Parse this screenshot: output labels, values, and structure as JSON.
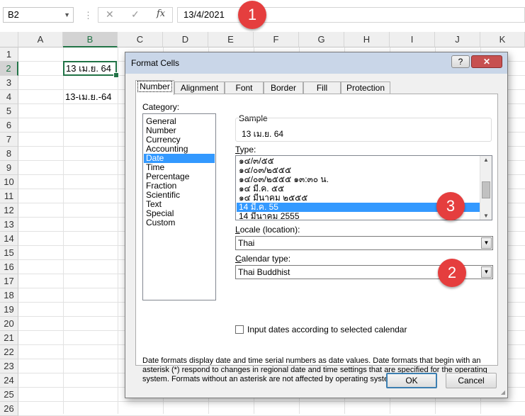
{
  "formula_bar": {
    "name_box": "B2",
    "cancel_symbol": "✕",
    "enter_symbol": "✓",
    "fx_symbol": "fx",
    "formula": "13/4/2021"
  },
  "sheet": {
    "columns": [
      "A",
      "B",
      "C",
      "D",
      "E",
      "F",
      "G",
      "H",
      "I",
      "J",
      "K"
    ],
    "selected_column": "B",
    "rows": [
      "1",
      "2",
      "3",
      "4",
      "5",
      "6",
      "7",
      "8",
      "9",
      "10",
      "11",
      "12",
      "13",
      "14",
      "15",
      "16",
      "17",
      "18",
      "19",
      "20",
      "21",
      "22",
      "23",
      "24",
      "25",
      "26"
    ],
    "selected_row": "2",
    "cells": {
      "B2": "13 เม.ย. 64",
      "B4": "13-เม.ย.-64"
    }
  },
  "badges": [
    "1",
    "2",
    "3"
  ],
  "dialog": {
    "title": "Format Cells",
    "help": "?",
    "close": "✕",
    "tabs": [
      "Number",
      "Alignment",
      "Font",
      "Border",
      "Fill",
      "Protection"
    ],
    "active_tab": "Number",
    "category_label": "Category:",
    "categories": [
      "General",
      "Number",
      "Currency",
      "Accounting",
      "Date",
      "Time",
      "Percentage",
      "Fraction",
      "Scientific",
      "Text",
      "Special",
      "Custom"
    ],
    "selected_category": "Date",
    "sample_label": "Sample",
    "sample_value": "13 เม.ย. 64",
    "type_label": "Type:",
    "types": [
      "๑๔/๓/๕๕",
      "๑๔/๐๓/๒๕๕๕",
      "๑๔/๐๓/๒๕๕๕ ๑๓:๓๐ น.",
      "๑๔ มี.ค. ๕๕",
      "๑๔ มีนาคม ๒๕๕๕",
      "14 มี.ค. 55",
      "14 มีนาคม 2555"
    ],
    "selected_type": "14 มี.ค. 55",
    "locale_label": "Locale (location):",
    "locale_value": "Thai",
    "calendar_label": "Calendar type:",
    "calendar_value": "Thai Buddhist",
    "checkbox_label": "Input dates according to selected calendar",
    "checkbox_checked": false,
    "description": "Date formats display date and time serial numbers as date values.  Date formats that begin with an asterisk (*) respond to changes in regional date and time settings that are specified for the operating system. Formats without an asterisk are not affected by operating system settings.",
    "ok_label": "OK",
    "cancel_label": "Cancel"
  },
  "colors": {
    "excel_green": "#217346",
    "selection_blue": "#3399ff",
    "badge_red": "#e53e3e",
    "title_bar": "#c9d6e8"
  }
}
